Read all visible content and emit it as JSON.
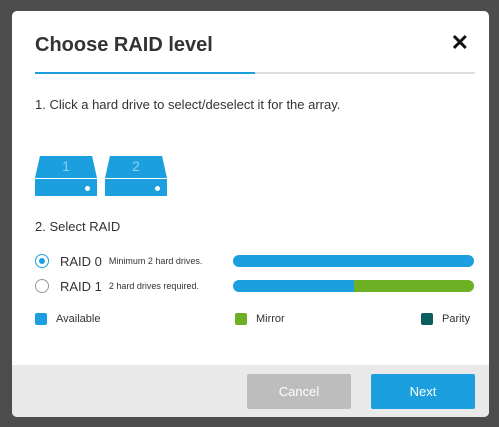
{
  "dialog": {
    "title": "Choose RAID level",
    "close_symbol": "✕",
    "wizard_progress": 0.5
  },
  "step1": {
    "text": "1. Click a hard drive to select/deselect it for the array."
  },
  "drives": [
    {
      "number": "1",
      "selected": true
    },
    {
      "number": "2",
      "selected": true
    }
  ],
  "step2": {
    "text": "2. Select RAID"
  },
  "raid_options": [
    {
      "name": "RAID 0",
      "description": "Minimum 2 hard drives.",
      "selected": true,
      "capacity": {
        "available": 1.0,
        "mirror": 0.0,
        "parity": 0.0
      }
    },
    {
      "name": "RAID 1",
      "description": "2 hard drives required.",
      "selected": false,
      "capacity": {
        "available": 0.5,
        "mirror": 0.5,
        "parity": 0.0
      }
    }
  ],
  "legend": [
    {
      "label": "Available",
      "color": "#1b9fde"
    },
    {
      "label": "Mirror",
      "color": "#6eb023"
    },
    {
      "label": "Parity",
      "color": "#0b5e60"
    }
  ],
  "buttons": {
    "cancel": "Cancel",
    "next": "Next"
  },
  "colors": {
    "accent": "#1b9fde",
    "cancel_disabled": "#bdbdbd",
    "footer_bg": "#e9e9e9"
  }
}
